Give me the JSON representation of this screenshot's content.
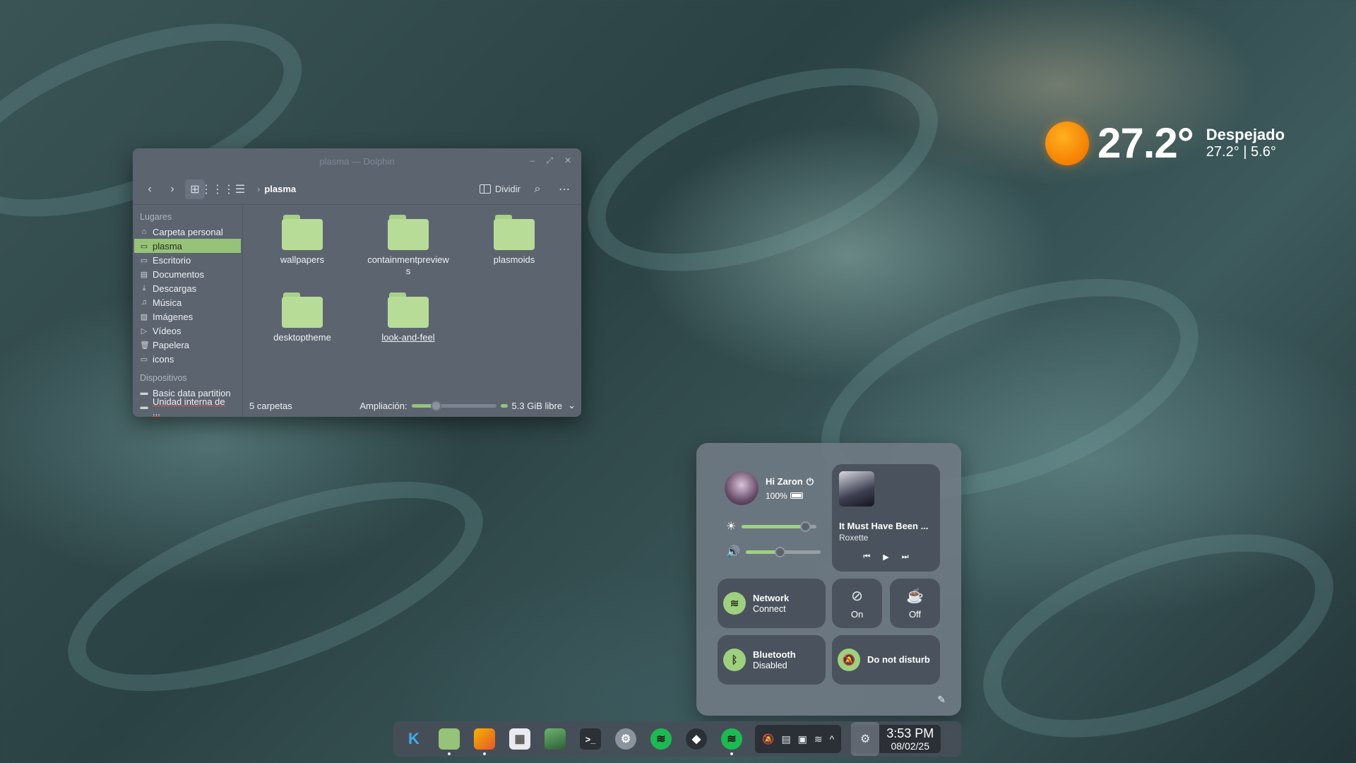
{
  "weather": {
    "temperature": "27.2°",
    "condition": "Despejado",
    "range": "27.2° | 5.6°"
  },
  "dolphin": {
    "title": "plasma — Dolphin",
    "toolbar": {
      "breadcrumb": "plasma",
      "split_label": "Dividir"
    },
    "sidebar": {
      "places_header": "Lugares",
      "places": [
        {
          "label": "Carpeta personal",
          "icon": "home-icon"
        },
        {
          "label": "plasma",
          "icon": "folder-icon"
        },
        {
          "label": "Escritorio",
          "icon": "desktop-icon"
        },
        {
          "label": "Documentos",
          "icon": "document-icon"
        },
        {
          "label": "Descargas",
          "icon": "download-icon"
        },
        {
          "label": "Música",
          "icon": "music-icon"
        },
        {
          "label": "Imágenes",
          "icon": "image-icon"
        },
        {
          "label": "Vídeos",
          "icon": "video-icon"
        },
        {
          "label": "Papelera",
          "icon": "trash-icon"
        },
        {
          "label": "icons",
          "icon": "folder-icon"
        }
      ],
      "devices_header": "Dispositivos",
      "devices": [
        {
          "label": "Basic data partition",
          "icon": "drive-icon"
        },
        {
          "label": "Unidad interna de ...",
          "icon": "drive-icon"
        }
      ]
    },
    "folders": [
      "wallpapers",
      "containmentpreviews",
      "plasmoids",
      "desktoptheme",
      "look-and-feel"
    ],
    "status": {
      "count": "5 carpetas",
      "zoom_label": "Ampliación:",
      "free_space": "5.3 GiB libre"
    }
  },
  "control_center": {
    "user": {
      "greeting": "Hi Zaron",
      "battery": "100%"
    },
    "brightness": 0.85,
    "volume": 0.45,
    "media": {
      "title": "It Must Have Been ...",
      "artist": "Roxette"
    },
    "network": {
      "title": "Network",
      "subtitle": "Connect"
    },
    "caffeine": {
      "state": "On"
    },
    "coffee": {
      "state": "Off"
    },
    "bluetooth": {
      "title": "Bluetooth",
      "subtitle": "Disabled"
    },
    "dnd": {
      "title": "Do not disturb"
    }
  },
  "taskbar": {
    "time": "3:53 PM",
    "date": "08/02/25"
  },
  "colors": {
    "accent": "#97c27a",
    "panel": "#5c6470"
  }
}
